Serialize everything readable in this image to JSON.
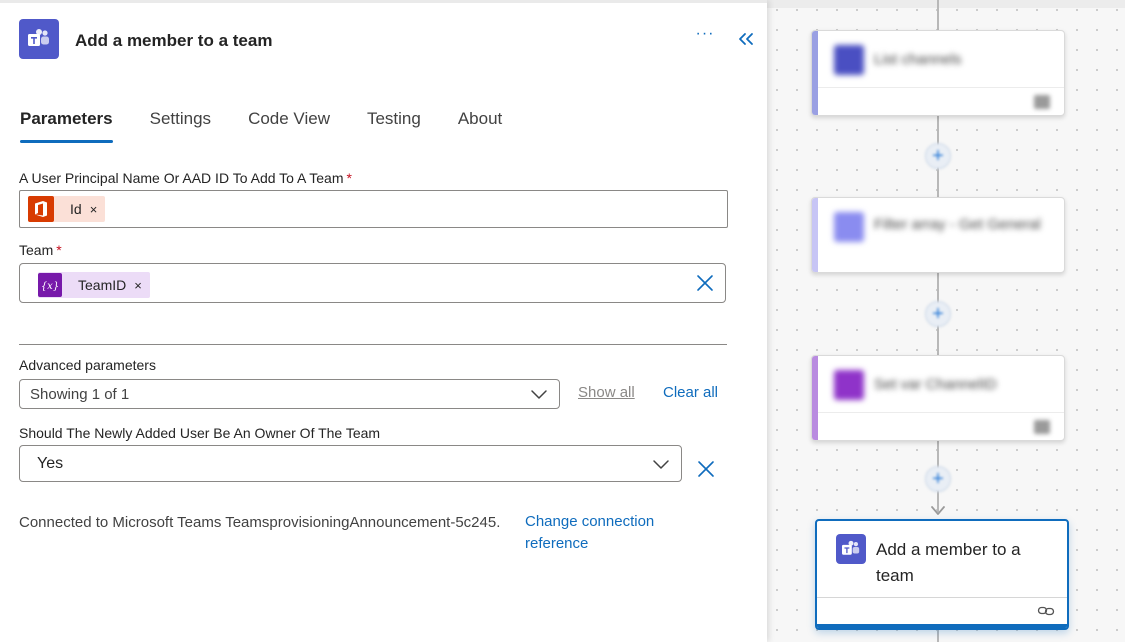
{
  "panel": {
    "title": "Add a member to a team",
    "more_label": "···",
    "tabs": [
      {
        "label": "Parameters",
        "active": true
      },
      {
        "label": "Settings",
        "active": false
      },
      {
        "label": "Code View",
        "active": false
      },
      {
        "label": "Testing",
        "active": false
      },
      {
        "label": "About",
        "active": false
      }
    ],
    "fields": {
      "user": {
        "label": "A User Principal Name Or AAD ID To Add To A Team",
        "required_mark": "*",
        "token": {
          "label": "Id",
          "remove": "×",
          "icon": "office-icon",
          "color": "#d83b01",
          "bg": "#fbe0d7"
        }
      },
      "team": {
        "label": "Team",
        "required_mark": "*",
        "token": {
          "label": "TeamID",
          "remove": "×",
          "icon": "variable-icon",
          "color": "#7719aa",
          "bg": "#ecdcf7"
        }
      }
    },
    "advanced": {
      "label": "Advanced parameters",
      "selected": "Showing 1 of 1",
      "show_all": "Show all",
      "clear_all": "Clear all"
    },
    "owner": {
      "label": "Should The Newly Added User Be An Owner Of The Team",
      "selected": "Yes"
    },
    "connection": {
      "text": "Connected to Microsoft Teams TeamsprovisioningAnnouncement-5c245.",
      "link": "Change connection reference"
    }
  },
  "canvas": {
    "nodes": [
      {
        "title": "List channels",
        "accent": "#4a4fc2"
      },
      {
        "title": "Filter array - Get General",
        "accent": "#8a8cf0"
      },
      {
        "title": "Set var ChannelID",
        "accent": "#8f33c9"
      }
    ],
    "selected_node": {
      "title": "Add a member to a team",
      "icon": "teams-icon"
    },
    "add_step_label": "+"
  },
  "colors": {
    "accent": "#0f6cbd",
    "teams": "#5059c9",
    "required": "#c50f1f"
  }
}
